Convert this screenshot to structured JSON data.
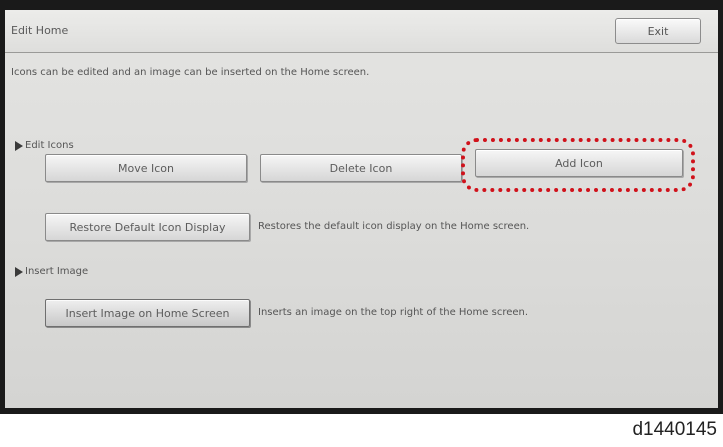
{
  "window": {
    "title": "Edit Home",
    "exit_label": "Exit"
  },
  "description": "Icons can be edited and an image can be inserted on the Home screen.",
  "edit_icons": {
    "section_label": "Edit Icons",
    "move_label": "Move Icon",
    "delete_label": "Delete Icon",
    "add_label": "Add Icon",
    "restore_label": "Restore Default Icon Display",
    "restore_desc": "Restores the default icon display on the Home screen."
  },
  "insert_image": {
    "section_label": "Insert Image",
    "insert_label": "Insert Image on Home Screen",
    "insert_desc": "Inserts an image on the top right of the Home screen."
  },
  "highlight": {
    "color": "#d0121b",
    "target": "Add Icon"
  },
  "figure_id": "d1440145"
}
